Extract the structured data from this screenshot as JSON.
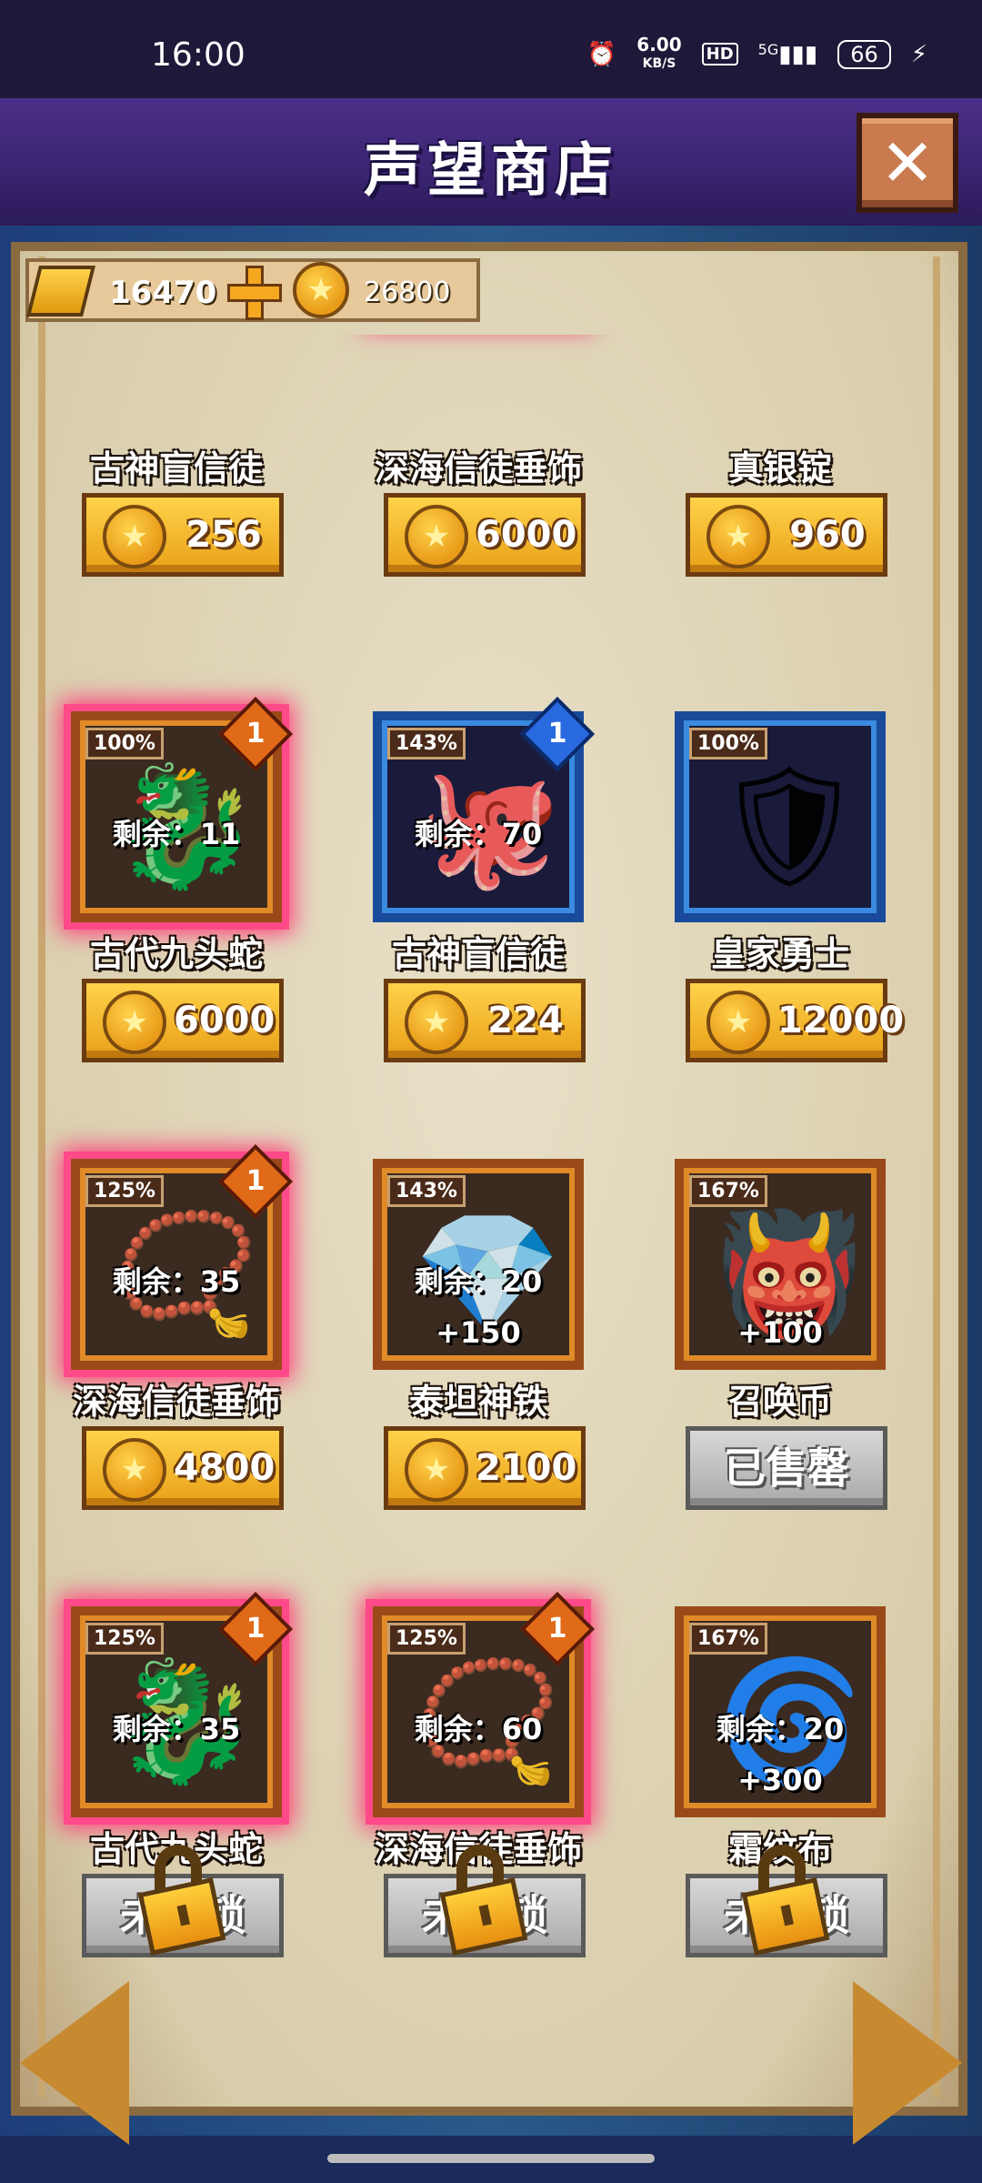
{
  "status_bar": {
    "time": "16:00",
    "net_speed_value": "6.00",
    "net_speed_unit": "KB/S",
    "hd": "HD",
    "signal": "5G",
    "battery": "66"
  },
  "header": {
    "title": "声望商店",
    "close_label": "✕"
  },
  "currency": {
    "ingots": "16470",
    "coins": "26800"
  },
  "row0": [
    {
      "name": "古神盲信徒",
      "price": "256"
    },
    {
      "name": "深海信徒垂饰",
      "price": "6000"
    },
    {
      "name": "真银锭",
      "price": "960"
    }
  ],
  "row1": [
    {
      "name": "古代九头蛇",
      "price": "6000",
      "pct": "100%",
      "badge": "1",
      "remain": "剩余：11"
    },
    {
      "name": "古神盲信徒",
      "price": "224",
      "pct": "143%",
      "badge": "1",
      "remain": "剩余：70"
    },
    {
      "name": "皇家勇士",
      "price": "12000",
      "pct": "100%"
    }
  ],
  "row2": [
    {
      "name": "深海信徒垂饰",
      "price": "4800",
      "pct": "125%",
      "badge": "1",
      "remain": "剩余：35"
    },
    {
      "name": "泰坦神铁",
      "price": "2100",
      "pct": "143%",
      "remain": "剩余：20",
      "bonus": "+150"
    },
    {
      "name": "召唤币",
      "status": "已售罄",
      "pct": "167%",
      "bonus": "+100"
    }
  ],
  "row3": [
    {
      "name": "古代九头蛇",
      "status": "未解锁",
      "pct": "125%",
      "badge": "1",
      "remain": "剩余：35"
    },
    {
      "name": "深海信徒垂饰",
      "status": "未解锁",
      "pct": "125%",
      "badge": "1",
      "remain": "剩余：60"
    },
    {
      "name": "霜纹布",
      "status": "未解锁",
      "pct": "167%",
      "remain": "剩余：20",
      "bonus": "+300"
    }
  ]
}
